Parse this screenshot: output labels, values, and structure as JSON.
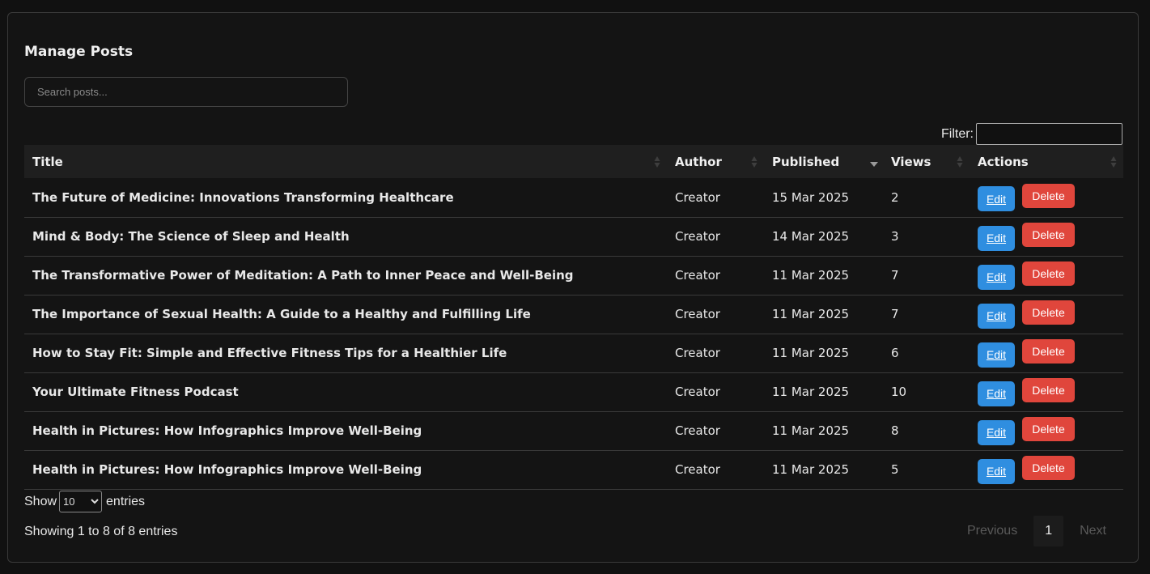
{
  "page": {
    "title": "Manage Posts",
    "search_placeholder": "Search posts..."
  },
  "filter": {
    "label": "Filter:",
    "value": ""
  },
  "table": {
    "columns": [
      "Title",
      "Author",
      "Published",
      "Views",
      "Actions"
    ],
    "sorted_column": "Published",
    "sort_direction": "descending",
    "edit_label": "Edit",
    "delete_label": "Delete",
    "rows": [
      {
        "title": "The Future of Medicine: Innovations Transforming Healthcare",
        "author": "Creator",
        "published": "15 Mar 2025",
        "views": "2"
      },
      {
        "title": "Mind & Body: The Science of Sleep and Health",
        "author": "Creator",
        "published": "14 Mar 2025",
        "views": "3"
      },
      {
        "title": "The Transformative Power of Meditation: A Path to Inner Peace and Well-Being",
        "author": "Creator",
        "published": "11 Mar 2025",
        "views": "7"
      },
      {
        "title": "The Importance of Sexual Health: A Guide to a Healthy and Fulfilling Life",
        "author": "Creator",
        "published": "11 Mar 2025",
        "views": "7"
      },
      {
        "title": "How to Stay Fit: Simple and Effective Fitness Tips for a Healthier Life",
        "author": "Creator",
        "published": "11 Mar 2025",
        "views": "6"
      },
      {
        "title": "Your Ultimate Fitness Podcast",
        "author": "Creator",
        "published": "11 Mar 2025",
        "views": "10"
      },
      {
        "title": "Health in Pictures: How Infographics Improve Well-Being",
        "author": "Creator",
        "published": "11 Mar 2025",
        "views": "8"
      },
      {
        "title": "Health in Pictures: How Infographics Improve Well-Being",
        "author": "Creator",
        "published": "11 Mar 2025",
        "views": "5"
      }
    ]
  },
  "length": {
    "show_label": "Show",
    "selected": "10",
    "entries_label": "entries"
  },
  "info": "Showing 1 to 8 of 8 entries",
  "pagination": {
    "previous": "Previous",
    "current": "1",
    "next": "Next"
  },
  "colors": {
    "background": "#111111",
    "edit_button": "#2f8ee0",
    "delete_button": "#e0463c"
  },
  "icons": {
    "sort": "sort-both-icon",
    "sort_desc": "sort-desc-icon"
  }
}
